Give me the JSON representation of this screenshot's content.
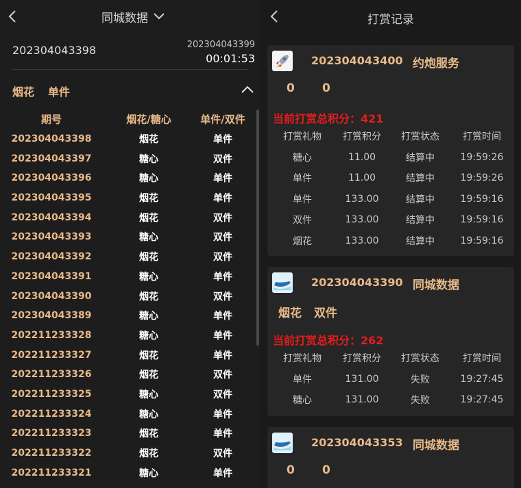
{
  "left": {
    "title": "同城数据",
    "current_issue": "202304043398",
    "next_issue": "202304043399",
    "countdown": "00:01:53",
    "latest_result": {
      "a": "烟花",
      "b": "单件"
    },
    "columns": [
      "期号",
      "烟花/糖心",
      "单件/双件"
    ],
    "rows": [
      {
        "issue": "202304043398",
        "type": "烟花",
        "odd": "单件"
      },
      {
        "issue": "202304043397",
        "type": "糖心",
        "odd": "双件"
      },
      {
        "issue": "202304043396",
        "type": "糖心",
        "odd": "单件"
      },
      {
        "issue": "202304043395",
        "type": "烟花",
        "odd": "单件"
      },
      {
        "issue": "202304043394",
        "type": "烟花",
        "odd": "双件"
      },
      {
        "issue": "202304043393",
        "type": "糖心",
        "odd": "双件"
      },
      {
        "issue": "202304043392",
        "type": "烟花",
        "odd": "双件"
      },
      {
        "issue": "202304043391",
        "type": "糖心",
        "odd": "单件"
      },
      {
        "issue": "202304043390",
        "type": "烟花",
        "odd": "双件"
      },
      {
        "issue": "202304043389",
        "type": "糖心",
        "odd": "单件"
      },
      {
        "issue": "202211233328",
        "type": "糖心",
        "odd": "单件"
      },
      {
        "issue": "202211233327",
        "type": "烟花",
        "odd": "单件"
      },
      {
        "issue": "202211233326",
        "type": "烟花",
        "odd": "双件"
      },
      {
        "issue": "202211233325",
        "type": "糖心",
        "odd": "双件"
      },
      {
        "issue": "202211233324",
        "type": "糖心",
        "odd": "单件"
      },
      {
        "issue": "202211233323",
        "type": "烟花",
        "odd": "单件"
      },
      {
        "issue": "202211233322",
        "type": "烟花",
        "odd": "双件"
      },
      {
        "issue": "202211233321",
        "type": "糖心",
        "odd": "单件"
      }
    ]
  },
  "right": {
    "title": "打赏记录",
    "total_label": "当前打赏总积分：",
    "table_headers": [
      "打赏礼物",
      "打赏积分",
      "打赏状态",
      "打赏时间"
    ],
    "cards": [
      {
        "issue": "202304043400",
        "name": "约炮服务",
        "avatar_icon": "rocket-icon",
        "result_a": "0",
        "result_b": "0",
        "total": "421",
        "records": [
          {
            "gift": "糖心",
            "points": "11.00",
            "status": "结算中",
            "time": "19:59:26"
          },
          {
            "gift": "单件",
            "points": "11.00",
            "status": "结算中",
            "time": "19:59:26"
          },
          {
            "gift": "单件",
            "points": "133.00",
            "status": "结算中",
            "time": "19:59:16"
          },
          {
            "gift": "双件",
            "points": "133.00",
            "status": "结算中",
            "time": "19:59:16"
          },
          {
            "gift": "烟花",
            "points": "133.00",
            "status": "结算中",
            "time": "19:59:16"
          }
        ]
      },
      {
        "issue": "202304043390",
        "name": "同城数据",
        "avatar_icon": "speedboat-icon",
        "result_a": "烟花",
        "result_b": "双件",
        "total": "262",
        "records": [
          {
            "gift": "单件",
            "points": "131.00",
            "status": "失败",
            "time": "19:27:45"
          },
          {
            "gift": "糖心",
            "points": "131.00",
            "status": "失败",
            "time": "19:27:45"
          }
        ]
      },
      {
        "issue": "202304043353",
        "name": "同城数据",
        "avatar_icon": "speedboat-icon",
        "result_a": "0",
        "result_b": "0"
      }
    ]
  },
  "colors": {
    "accent_gold": "#e8b98a",
    "total_red": "#e81c1c",
    "card_bg": "#262626",
    "page_bg": "#1c1c1c"
  }
}
